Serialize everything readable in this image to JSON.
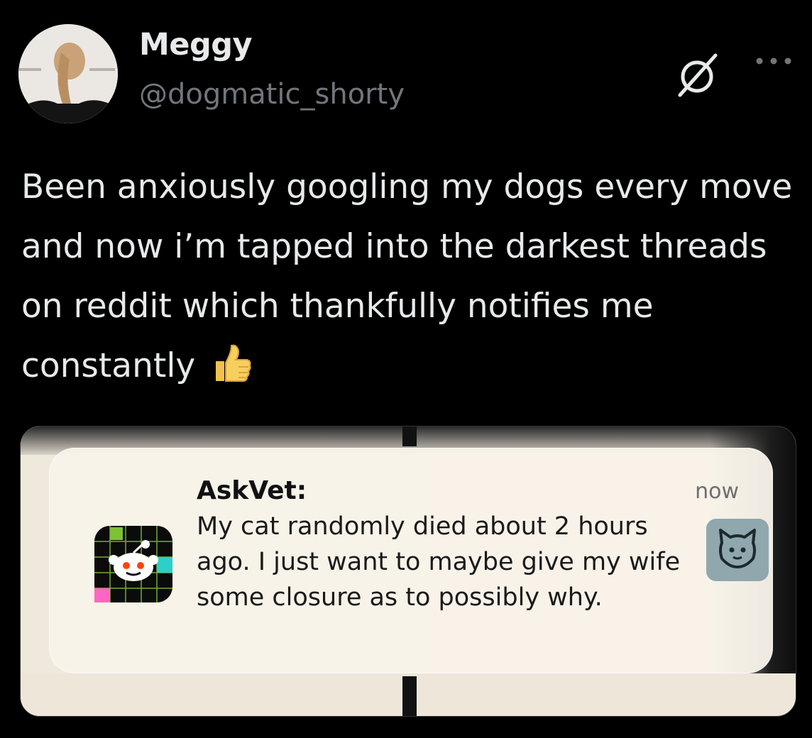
{
  "author": {
    "display_name": "Meggy",
    "handle": "@dogmatic_shorty"
  },
  "icons": {
    "avatar": "avatar",
    "grok": "grok-icon",
    "more": "more-icon",
    "thumb": "thumbs-up-emoji",
    "app": "reddit-app-icon",
    "thumbnail": "cat-face-thumbnail"
  },
  "tweet": {
    "text": "Been anxiously googling my dogs every move and now i’m tapped into the darkest threads on reddit which thankfully notifies me constantly"
  },
  "notification": {
    "title": "AskVet:",
    "time": "now",
    "body": "My cat randomly died about 2 hours ago. I just want to maybe give my wife some closure as to possibly why."
  },
  "colors": {
    "background": "#000000",
    "primary_text": "#e7e9ea",
    "secondary_text": "#71767b"
  }
}
